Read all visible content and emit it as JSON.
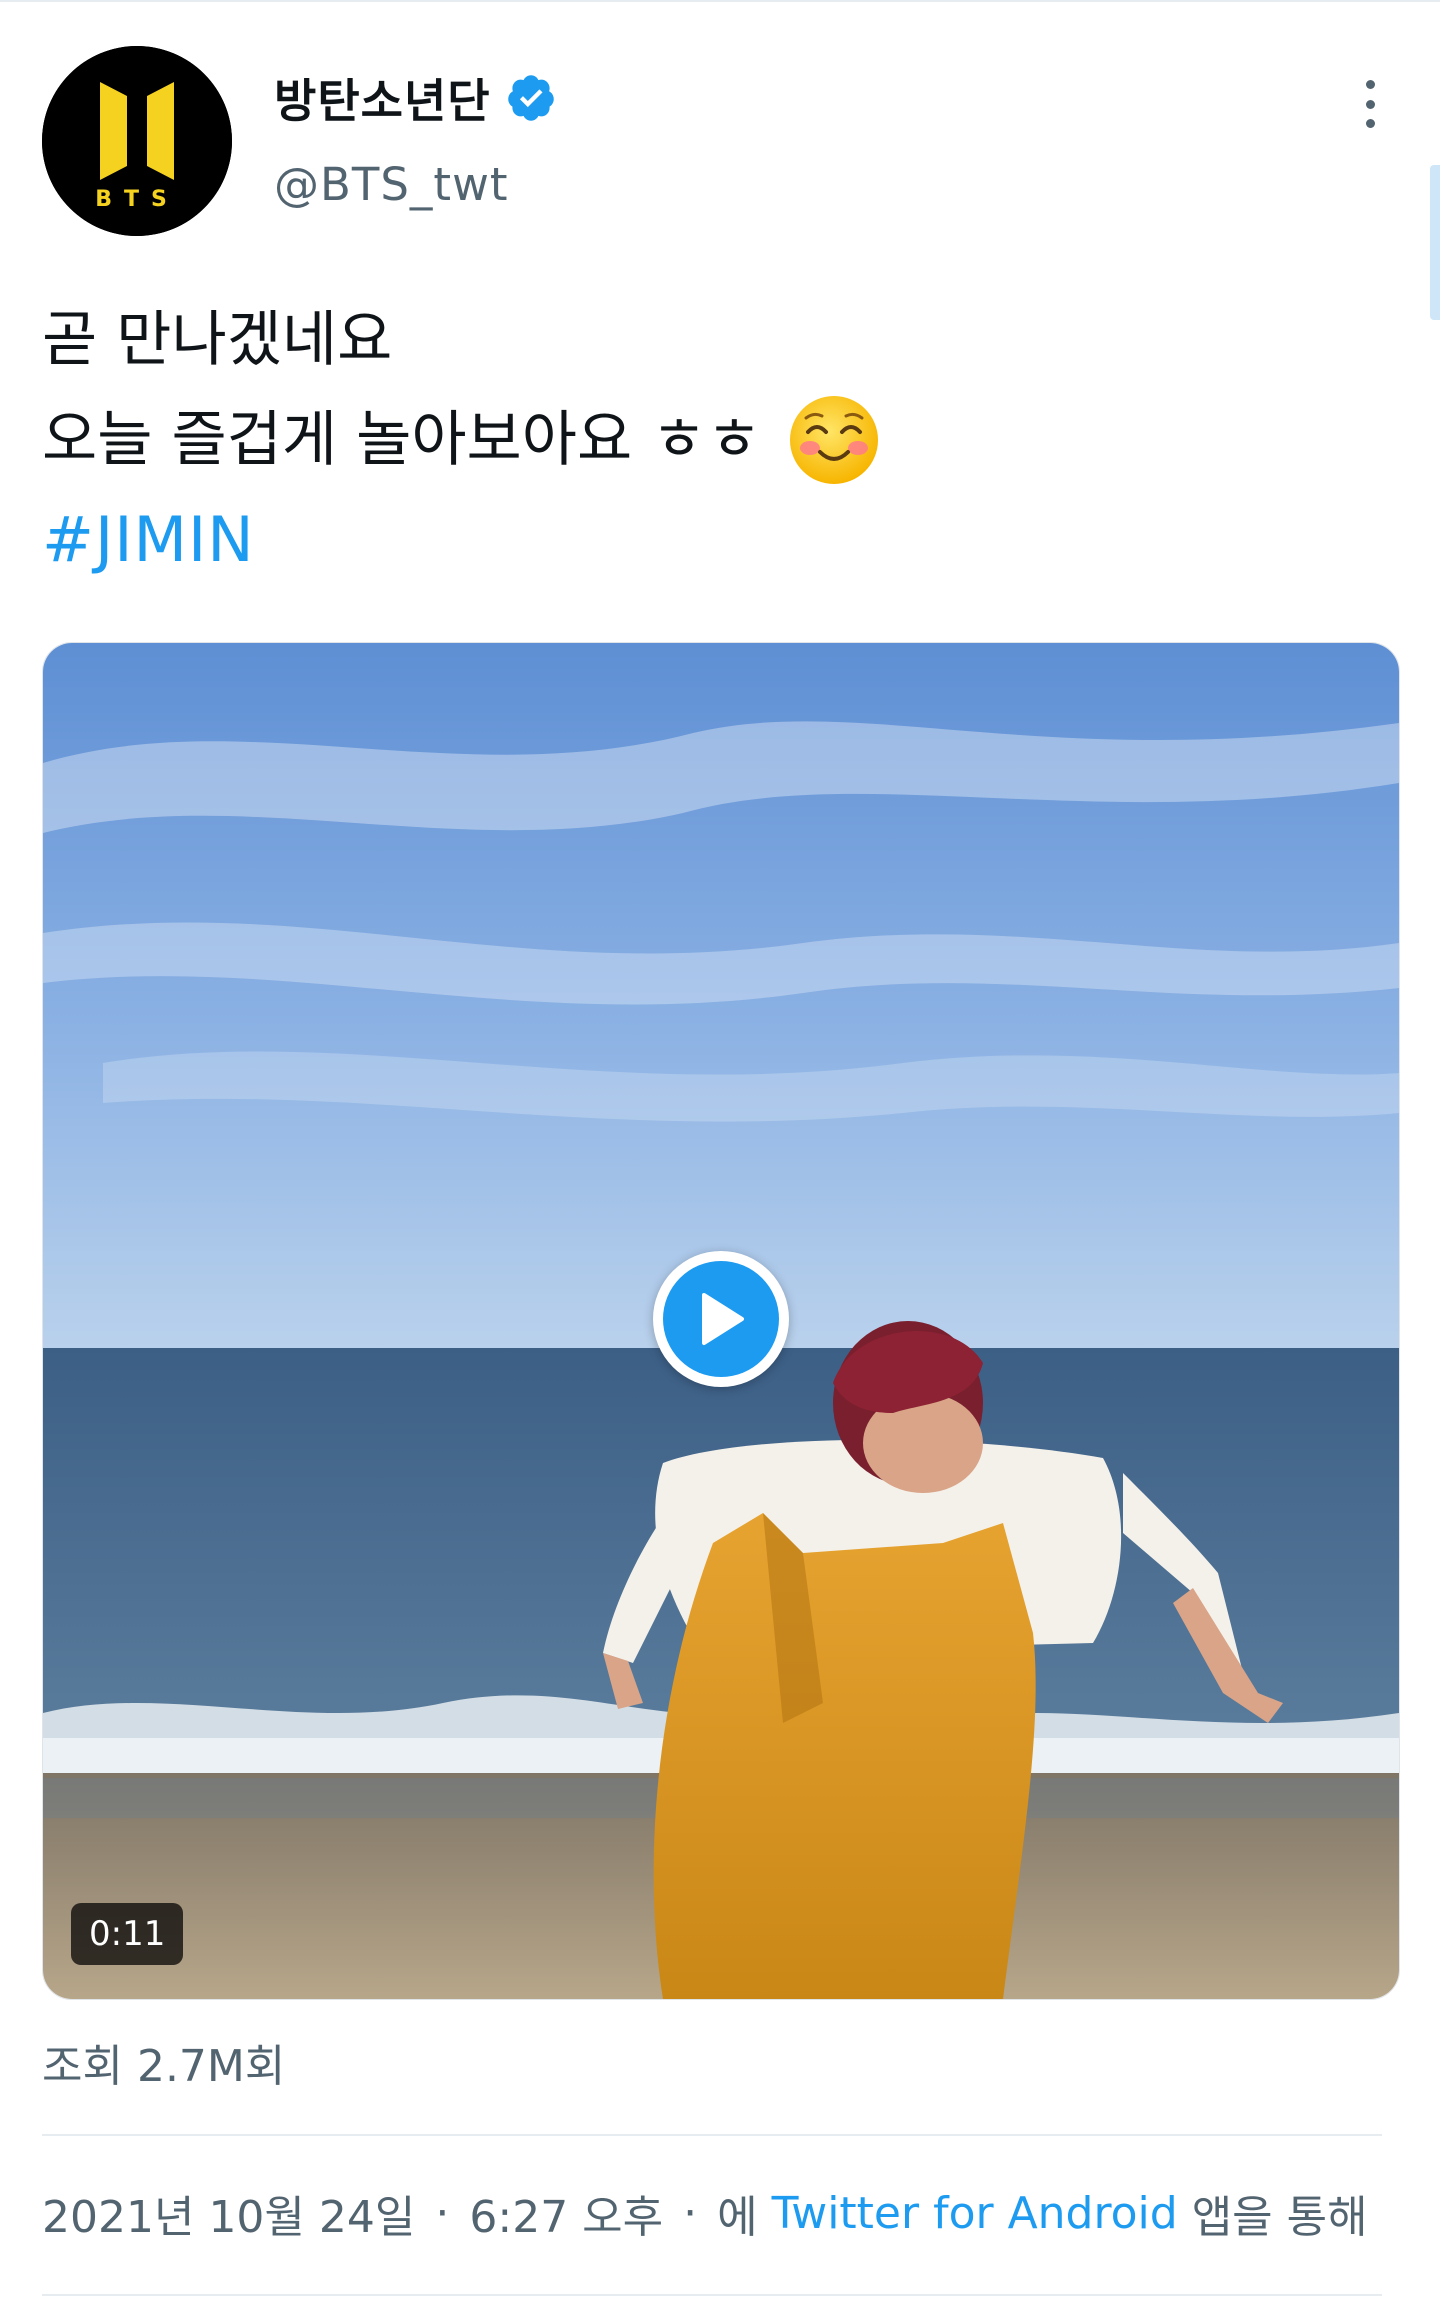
{
  "author": {
    "display_name": "방탄소년단",
    "handle": "@BTS_twt",
    "avatar_text": "BTS",
    "avatar_icon": "bts-logo-icon",
    "verified_icon": "verified-badge-icon"
  },
  "tweet": {
    "lines": [
      "곧 만나겠네요",
      "오늘 즐겁게 놀아보아요 ㅎㅎ"
    ],
    "emoji": "smiling-face-with-rosy-cheeks-icon",
    "hashtag": "#JIMIN"
  },
  "media": {
    "type": "video",
    "duration": "0:11",
    "play_icon": "play-icon"
  },
  "stats": {
    "views": "조회 2.7M회"
  },
  "meta": {
    "date": "2021년 10월 24일",
    "separator": "·",
    "time": "6:27 오후",
    "via_prefix": "에",
    "source": "Twitter for Android",
    "via_suffix": "앱을 통해"
  },
  "colors": {
    "accent": "#1d9bf0",
    "secondary_text": "#536471",
    "primary_text": "#0f1419",
    "bts_yellow": "#f4d21f"
  },
  "more_icon": "more-vertical-icon"
}
